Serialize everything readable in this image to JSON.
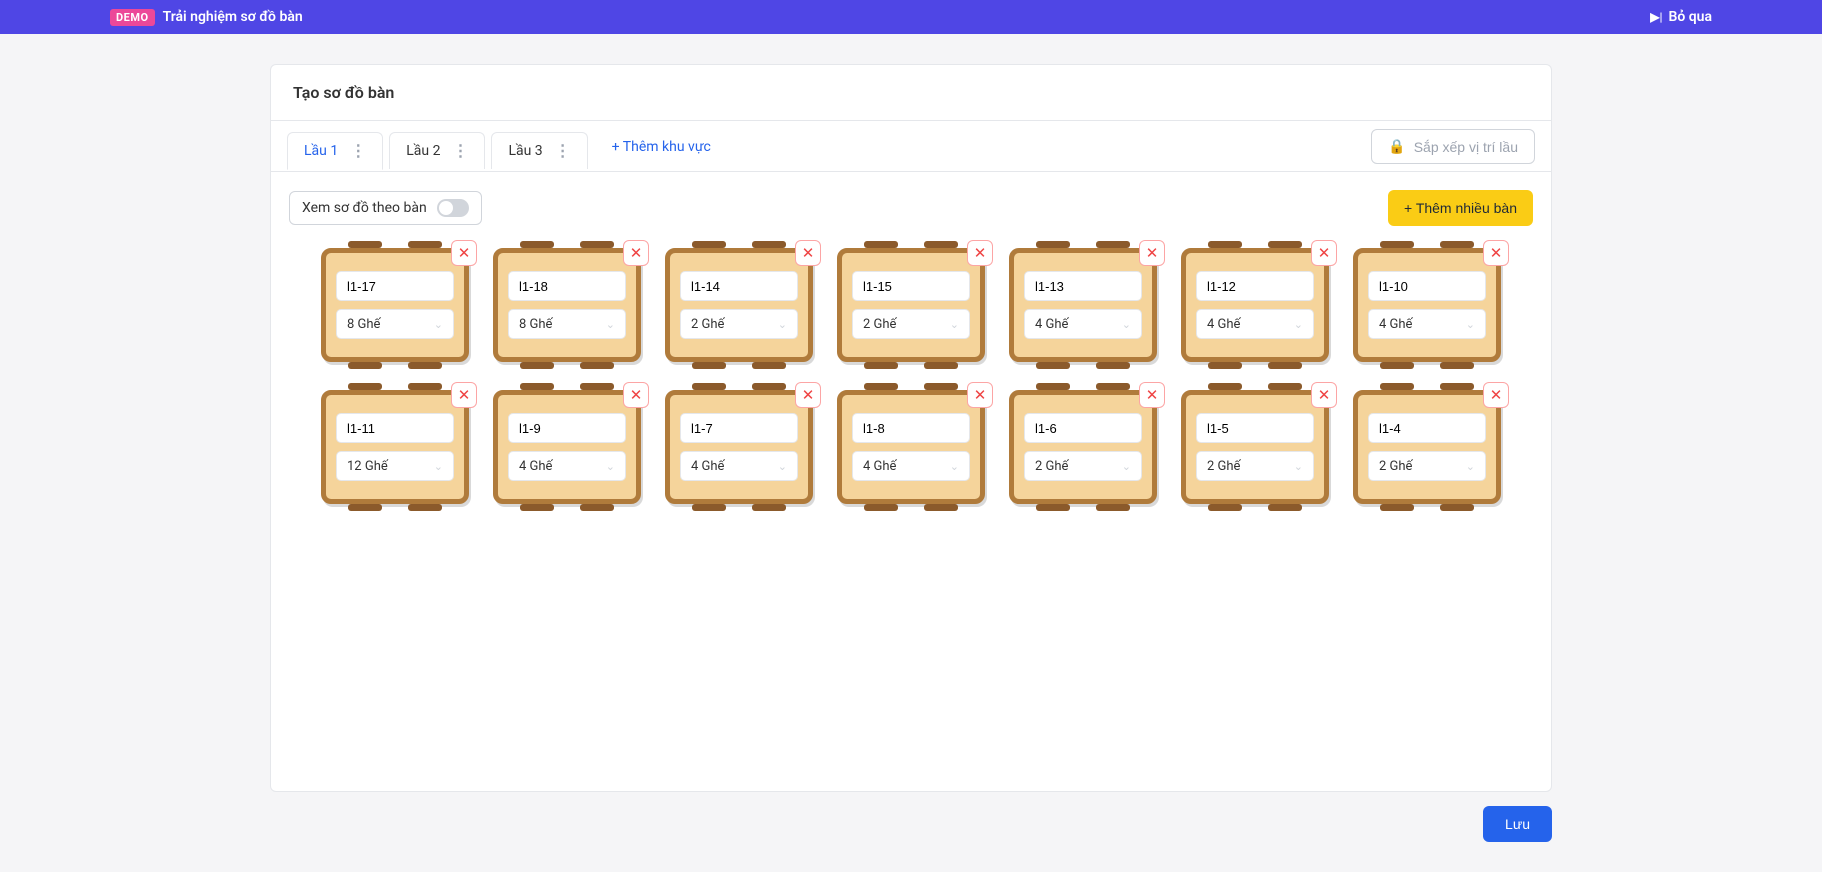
{
  "banner": {
    "badge": "DEMO",
    "title": "Trải nghiệm sơ đồ bàn",
    "skip": "Bỏ qua"
  },
  "header": {
    "title": "Tạo sơ đồ bàn"
  },
  "tabs": {
    "items": [
      {
        "label": "Lầu 1",
        "active": true
      },
      {
        "label": "Lầu 2",
        "active": false
      },
      {
        "label": "Lầu 3",
        "active": false
      }
    ],
    "add_label": "+ Thêm khu vực",
    "sort_label": "Sắp xếp vị trí lầu"
  },
  "toolbar": {
    "view_label": "Xem sơ đồ theo bàn",
    "add_many_label": "+ Thêm nhiều bàn"
  },
  "tables": [
    {
      "name": "l1-17",
      "seats": "8 Ghế"
    },
    {
      "name": "l1-18",
      "seats": "8 Ghế"
    },
    {
      "name": "l1-14",
      "seats": "2 Ghế"
    },
    {
      "name": "l1-15",
      "seats": "2 Ghế"
    },
    {
      "name": "l1-13",
      "seats": "4 Ghế"
    },
    {
      "name": "l1-12",
      "seats": "4 Ghế"
    },
    {
      "name": "l1-10",
      "seats": "4 Ghế"
    },
    {
      "name": "l1-11",
      "seats": "12 Ghế"
    },
    {
      "name": "l1-9",
      "seats": "4 Ghế"
    },
    {
      "name": "l1-7",
      "seats": "4 Ghế"
    },
    {
      "name": "l1-8",
      "seats": "4 Ghế"
    },
    {
      "name": "l1-6",
      "seats": "2 Ghế"
    },
    {
      "name": "l1-5",
      "seats": "2 Ghế"
    },
    {
      "name": "l1-4",
      "seats": "2 Ghế"
    }
  ],
  "footer": {
    "save": "Lưu"
  }
}
